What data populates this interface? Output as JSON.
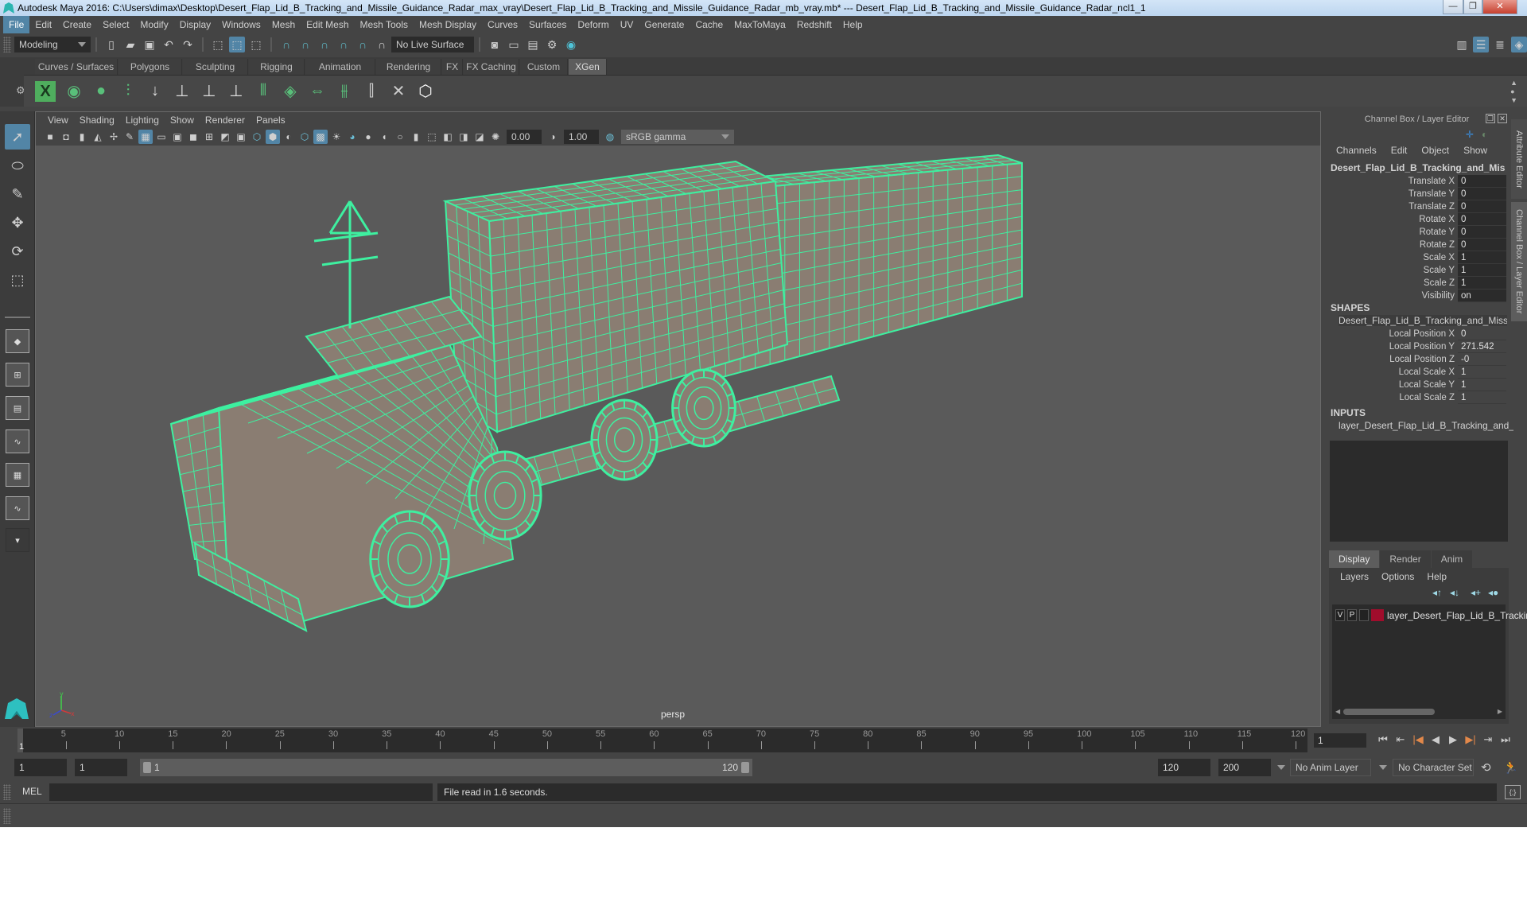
{
  "window": {
    "title": "Autodesk Maya 2016: C:\\Users\\dimax\\Desktop\\Desert_Flap_Lid_B_Tracking_and_Missile_Guidance_Radar_max_vray\\Desert_Flap_Lid_B_Tracking_and_Missile_Guidance_Radar_mb_vray.mb*   ---   Desert_Flap_Lid_B_Tracking_and_Missile_Guidance_Radar_ncl1_1",
    "controls": {
      "minimize": "—",
      "restore": "❐",
      "close": "✕"
    }
  },
  "menubar": [
    "File",
    "Edit",
    "Create",
    "Select",
    "Modify",
    "Display",
    "Windows",
    "Mesh",
    "Edit Mesh",
    "Mesh Tools",
    "Mesh Display",
    "Curves",
    "Surfaces",
    "Deform",
    "UV",
    "Generate",
    "Cache",
    "MaxToMaya",
    "Redshift",
    "Help"
  ],
  "statusline": {
    "mode": "Modeling",
    "live_surface": "No Live Surface"
  },
  "shelf": {
    "tabs": [
      "Curves / Surfaces",
      "Polygons",
      "Sculpting",
      "Rigging",
      "Animation",
      "Rendering",
      "FX",
      "FX Caching",
      "Custom",
      "XGen"
    ],
    "active_tab": "XGen",
    "icons": [
      "xgen-window-icon",
      "xgen-preview-icon",
      "xgen-clear-icon",
      "add-guides-icon",
      "place-guides-icon",
      "add-guide-icon",
      "sculpt-guide-icon",
      "lock-guide-icon",
      "bend-guides-icon",
      "grooming-icon",
      "flip-guides-icon",
      "select-guides-icon",
      "guide-cv-icon",
      "delete-guides-icon",
      "xgen-interactive-icon"
    ]
  },
  "viewport": {
    "menu": [
      "View",
      "Shading",
      "Lighting",
      "Show",
      "Renderer",
      "Panels"
    ],
    "exposure": "0.00",
    "gamma": "1.00",
    "color_space": "sRGB gamma",
    "camera": "persp",
    "wire_color": "#3ef0a0",
    "surface_color": "#8a7d72"
  },
  "channel_box": {
    "header": "Channel Box / Layer Editor",
    "menu": [
      "Channels",
      "Edit",
      "Object",
      "Show"
    ],
    "object_name": "Desert_Flap_Lid_B_Tracking_and_Missile...",
    "attributes": [
      {
        "label": "Translate X",
        "value": "0"
      },
      {
        "label": "Translate Y",
        "value": "0"
      },
      {
        "label": "Translate Z",
        "value": "0"
      },
      {
        "label": "Rotate X",
        "value": "0"
      },
      {
        "label": "Rotate Y",
        "value": "0"
      },
      {
        "label": "Rotate Z",
        "value": "0"
      },
      {
        "label": "Scale X",
        "value": "1"
      },
      {
        "label": "Scale Y",
        "value": "1"
      },
      {
        "label": "Scale Z",
        "value": "1"
      },
      {
        "label": "Visibility",
        "value": "on"
      }
    ],
    "shapes_label": "SHAPES",
    "shape_name": "Desert_Flap_Lid_B_Tracking_and_Missil...",
    "shape_attributes": [
      {
        "label": "Local Position X",
        "value": "0"
      },
      {
        "label": "Local Position Y",
        "value": "271.542"
      },
      {
        "label": "Local Position Z",
        "value": "-0"
      },
      {
        "label": "Local Scale X",
        "value": "1"
      },
      {
        "label": "Local Scale Y",
        "value": "1"
      },
      {
        "label": "Local Scale Z",
        "value": "1"
      }
    ],
    "inputs_label": "INPUTS",
    "input_name": "layer_Desert_Flap_Lid_B_Tracking_and_..."
  },
  "side_tabs": [
    "Attribute Editor",
    "Channel Box / Layer Editor"
  ],
  "layer_editor": {
    "tabs": [
      "Display",
      "Render",
      "Anim"
    ],
    "active_tab": "Display",
    "menu": [
      "Layers",
      "Options",
      "Help"
    ],
    "layers": [
      {
        "v": "V",
        "p": "P",
        "color": "#a00d2c",
        "name": "layer_Desert_Flap_Lid_B_Trackir"
      }
    ]
  },
  "timeline": {
    "ticks": [
      5,
      10,
      15,
      20,
      25,
      30,
      35,
      40,
      45,
      50,
      55,
      60,
      65,
      70,
      75,
      80,
      85,
      90,
      95,
      100,
      105,
      110,
      115,
      120
    ],
    "start": 1,
    "end": 120,
    "current_frame": "1",
    "current_label": "1"
  },
  "playback": {
    "buttons": [
      "⏮",
      "⇤",
      "|◀",
      "◀",
      "▶",
      "▶|",
      "⇥",
      "⏭"
    ]
  },
  "range": {
    "start_field": "1",
    "start_field2": "1",
    "slider_start": "1",
    "slider_end": "120",
    "end_field": "120",
    "end_field2": "200",
    "anim_layer": "No Anim Layer",
    "character_set": "No Character Set"
  },
  "command": {
    "language": "MEL",
    "output": "File read in  1.6 seconds."
  }
}
